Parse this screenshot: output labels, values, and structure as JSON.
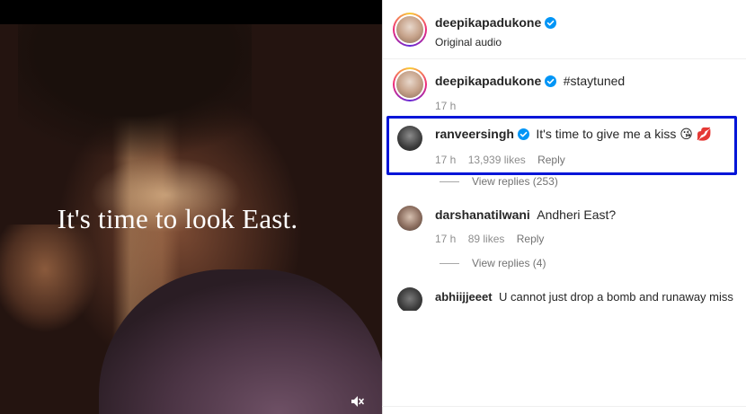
{
  "media": {
    "caption": "It's time to look East.",
    "mute_icon": "speaker-muted-icon"
  },
  "post_header": {
    "username": "deepikapadukone",
    "audio": "Original audio"
  },
  "caption_comment": {
    "username": "deepikapadukone",
    "text": "#staytuned",
    "time": "17 h"
  },
  "comments": [
    {
      "username": "ranveersingh",
      "verified": true,
      "text": "It's time to give me a kiss 😘 💋",
      "time": "17 h",
      "likes": "13,939 likes",
      "reply": "Reply",
      "view_replies": "View replies (253)",
      "highlighted": true
    },
    {
      "username": "darshanatilwani",
      "verified": false,
      "text": "Andheri East?",
      "time": "17 h",
      "likes": "89 likes",
      "reply": "Reply",
      "view_replies": "View replies (4)"
    },
    {
      "username": "abhiijjeeet",
      "verified": false,
      "text": "U cannot just drop a bomb and runaway miss"
    }
  ],
  "colors": {
    "highlight_border": "#0015d8",
    "verified_blue": "#0095f6",
    "hashtag": "#00376b"
  }
}
